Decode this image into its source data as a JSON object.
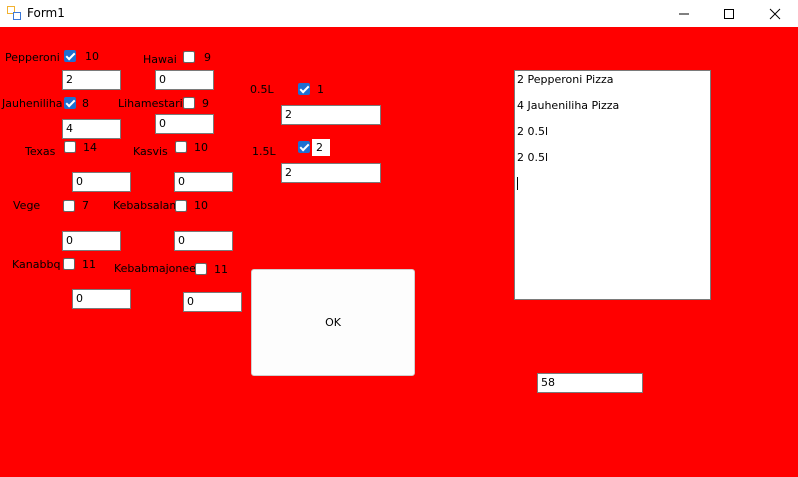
{
  "window": {
    "title": "Form1"
  },
  "labels": {
    "pepperoni": "Pepperoni",
    "hawai": "Hawai",
    "jauheniliha": "Jauheniliha",
    "lihamestari": "Lihamestari",
    "texas": "Texas",
    "kasvis": "Kasvis",
    "vege": "Vege",
    "kebabsalami": "Kebabsalami",
    "kanabbq": "Kanabbq",
    "kebabmajoneesi": "Kebabmajoneesi",
    "drink05": "0.5L",
    "drink15": "1.5L"
  },
  "checkboxes": {
    "pepperoni": {
      "checked": true,
      "text": "10"
    },
    "hawai": {
      "checked": false,
      "text": "9"
    },
    "jauheniliha": {
      "checked": true,
      "text": "8"
    },
    "lihamestari": {
      "checked": false,
      "text": "9"
    },
    "texas": {
      "checked": false,
      "text": "14"
    },
    "kasvis": {
      "checked": false,
      "text": "10"
    },
    "vege": {
      "checked": false,
      "text": "7"
    },
    "kebabsalami": {
      "checked": false,
      "text": "10"
    },
    "kanabbq": {
      "checked": false,
      "text": "11"
    },
    "kebabmajoneesi": {
      "checked": false,
      "text": "11"
    },
    "drink05": {
      "checked": true,
      "text": "1"
    },
    "drink15": {
      "checked": true,
      "text": "2"
    }
  },
  "inputs": {
    "pepperoni_qty": "2",
    "hawai_qty": "0",
    "jauheniliha_qty": "4",
    "lihamestari_qty": "0",
    "texas_qty": "0",
    "kasvis_qty": "0",
    "vege_qty": "0",
    "kebabsalami_qty": "0",
    "kanabbq_qty": "0",
    "kebabmajoneesi_qty": "0",
    "drink05_qty": "2",
    "drink15_qty": "2",
    "total": "58"
  },
  "ok_button": "OK",
  "order_list": [
    "2 Pepperoni Pizza",
    "4 Jauheniliha Pizza",
    "2 0.5l",
    "2 0.5l"
  ],
  "colors": {
    "form_background": "#ff0000",
    "checkbox_checked": "#1f6fd1"
  }
}
